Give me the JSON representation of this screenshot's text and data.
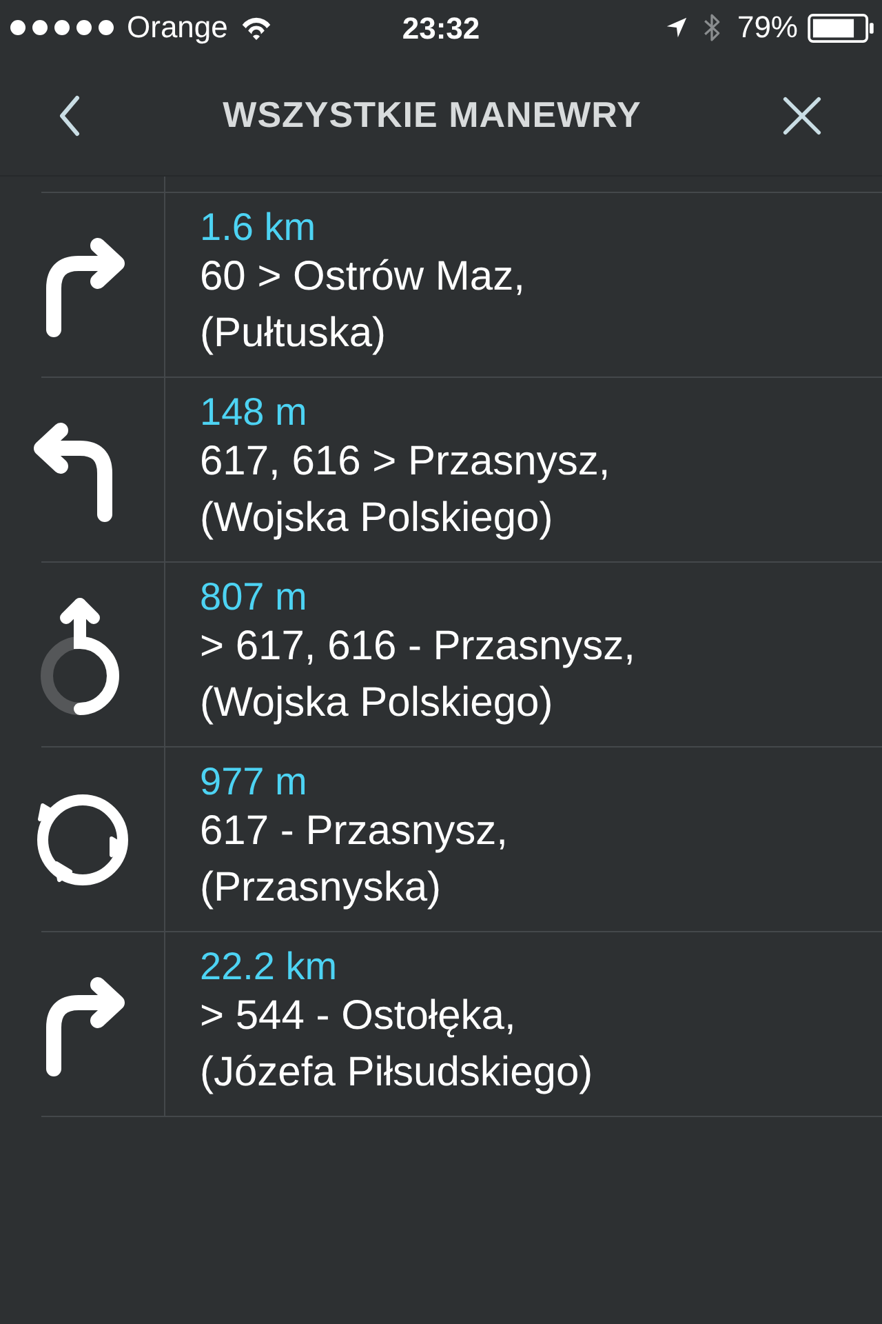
{
  "status_bar": {
    "carrier": "Orange",
    "time": "23:32",
    "battery": "79%"
  },
  "header": {
    "title": "WSZYSTKIE MANEWRY"
  },
  "maneuvers": [
    {
      "kind": "turn-right",
      "distance": "1.6 km",
      "direction": "60 > Ostrów Maz,",
      "street": "(Pułtuska)"
    },
    {
      "kind": "turn-left",
      "distance": "148 m",
      "direction": "617, 616 > Przasnysz,",
      "street": "(Wojska Polskiego)"
    },
    {
      "kind": "roundabout-exit",
      "distance": "807 m",
      "direction": "> 617, 616 - Przasnysz,",
      "street": "(Wojska Polskiego)"
    },
    {
      "kind": "roundabout",
      "distance": "977 m",
      "direction": "617 - Przasnysz,",
      "street": "(Przasnyska)"
    },
    {
      "kind": "turn-right",
      "distance": "22.2 km",
      "direction": "> 544 - Ostołęka,",
      "street": "(Józefa Piłsudskiego)"
    }
  ]
}
